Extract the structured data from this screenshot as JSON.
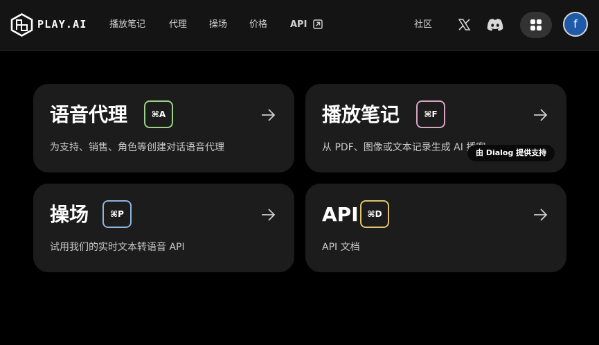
{
  "brand": {
    "name": "PLAY.AI"
  },
  "nav": {
    "items": [
      "播放笔记",
      "代理",
      "操场",
      "价格"
    ],
    "api_label": "API",
    "community": "社区",
    "avatar_letter": "f"
  },
  "cards": [
    {
      "title": "语音代理",
      "shortcut": "⌘A",
      "description": "为支持、销售、角色等创建对话语音代理",
      "accent": "#9bd186"
    },
    {
      "title": "播放笔记",
      "shortcut": "⌘F",
      "description": "从 PDF、图像或文本记录生成 AI 播客",
      "accent": "#d9a3c6"
    },
    {
      "title": "操场",
      "shortcut": "⌘P",
      "description": "试用我们的实时文本转语音 API",
      "accent": "#8fb4dd"
    },
    {
      "title": "API",
      "shortcut": "⌘D",
      "description": "API 文档",
      "accent": "#e0c36f"
    }
  ],
  "tooltip": {
    "text": "由 Dialog 提供支持"
  },
  "icons": {
    "logo": "play-ai-logo-icon",
    "external": "external-link-icon",
    "x": "x-icon",
    "discord": "discord-icon",
    "apps": "apps-grid-icon",
    "arrow": "arrow-right-icon"
  }
}
